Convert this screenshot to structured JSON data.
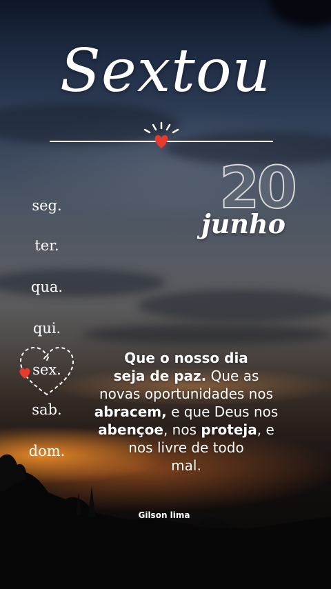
{
  "title": "Sextou",
  "date": {
    "day": "20",
    "month": "junho"
  },
  "weekdays": [
    "seg.",
    "ter.",
    "qua.",
    "qui.",
    "sex.",
    "sab.",
    "dom."
  ],
  "highlighted_day": "sex.",
  "message": {
    "line1": "Que o nosso dia",
    "line2_bold": "seja de paz.",
    "line2_rest": " Que as",
    "line3": "novas oportunidades nos",
    "line4_bold": "abracem,",
    "line4_rest": " e que Deus nos",
    "line5_bold_a": "abençoe",
    "line5_mid": ", nos ",
    "line5_bold_b": "proteja",
    "line5_rest": ", e",
    "line6": "nos livre de todo",
    "line7": "mal."
  },
  "author": "Gilson lima",
  "colors": {
    "accent_heart": "#e63b2e",
    "text": "#ffffff"
  },
  "icons": [
    "heart-icon",
    "heart-outline-icon",
    "sun-rays-icon"
  ]
}
